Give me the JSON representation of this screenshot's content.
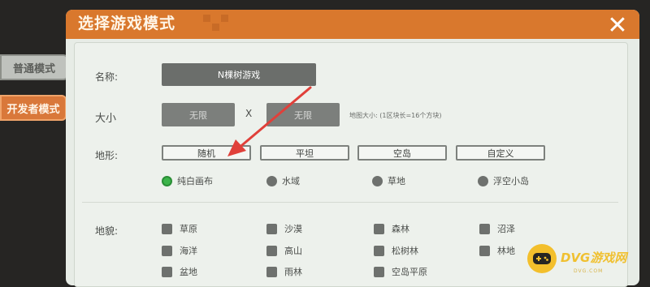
{
  "sidebar": {
    "tabs": [
      {
        "label": "普通模式",
        "active": false
      },
      {
        "label": "开发者模式",
        "active": true
      }
    ]
  },
  "dialog": {
    "title": "选择游戏模式",
    "close_icon": "close-icon"
  },
  "form": {
    "name_label": "名称:",
    "name_value": "N棵树游戏",
    "size_label": "大小",
    "size_width": "无限",
    "size_sep": "X",
    "size_height": "无限",
    "size_hint": "地图大小: (1区块长=16个方块)",
    "terrain_label": "地形:",
    "terrain_buttons": [
      "随机",
      "平坦",
      "空岛",
      "自定义"
    ],
    "terrain_options": [
      {
        "label": "纯白画布",
        "selected": true
      },
      {
        "label": "水域",
        "selected": false
      },
      {
        "label": "草地",
        "selected": false
      },
      {
        "label": "浮空小岛",
        "selected": false
      }
    ],
    "landform_label": "地貌:",
    "landforms": [
      [
        "草原",
        "沙漠",
        "森林",
        "沼泽"
      ],
      [
        "海洋",
        "高山",
        "松树林",
        "林地"
      ],
      [
        "盆地",
        "雨林",
        "空岛平原"
      ]
    ]
  },
  "watermark": {
    "text": "DVG游戏网",
    "url": "DVG.COM",
    "accent": "#f3bf2c"
  },
  "colors": {
    "title_bar": "#d9782d",
    "arrow": "#e0403a",
    "selected_radio": "#3cb44a"
  }
}
